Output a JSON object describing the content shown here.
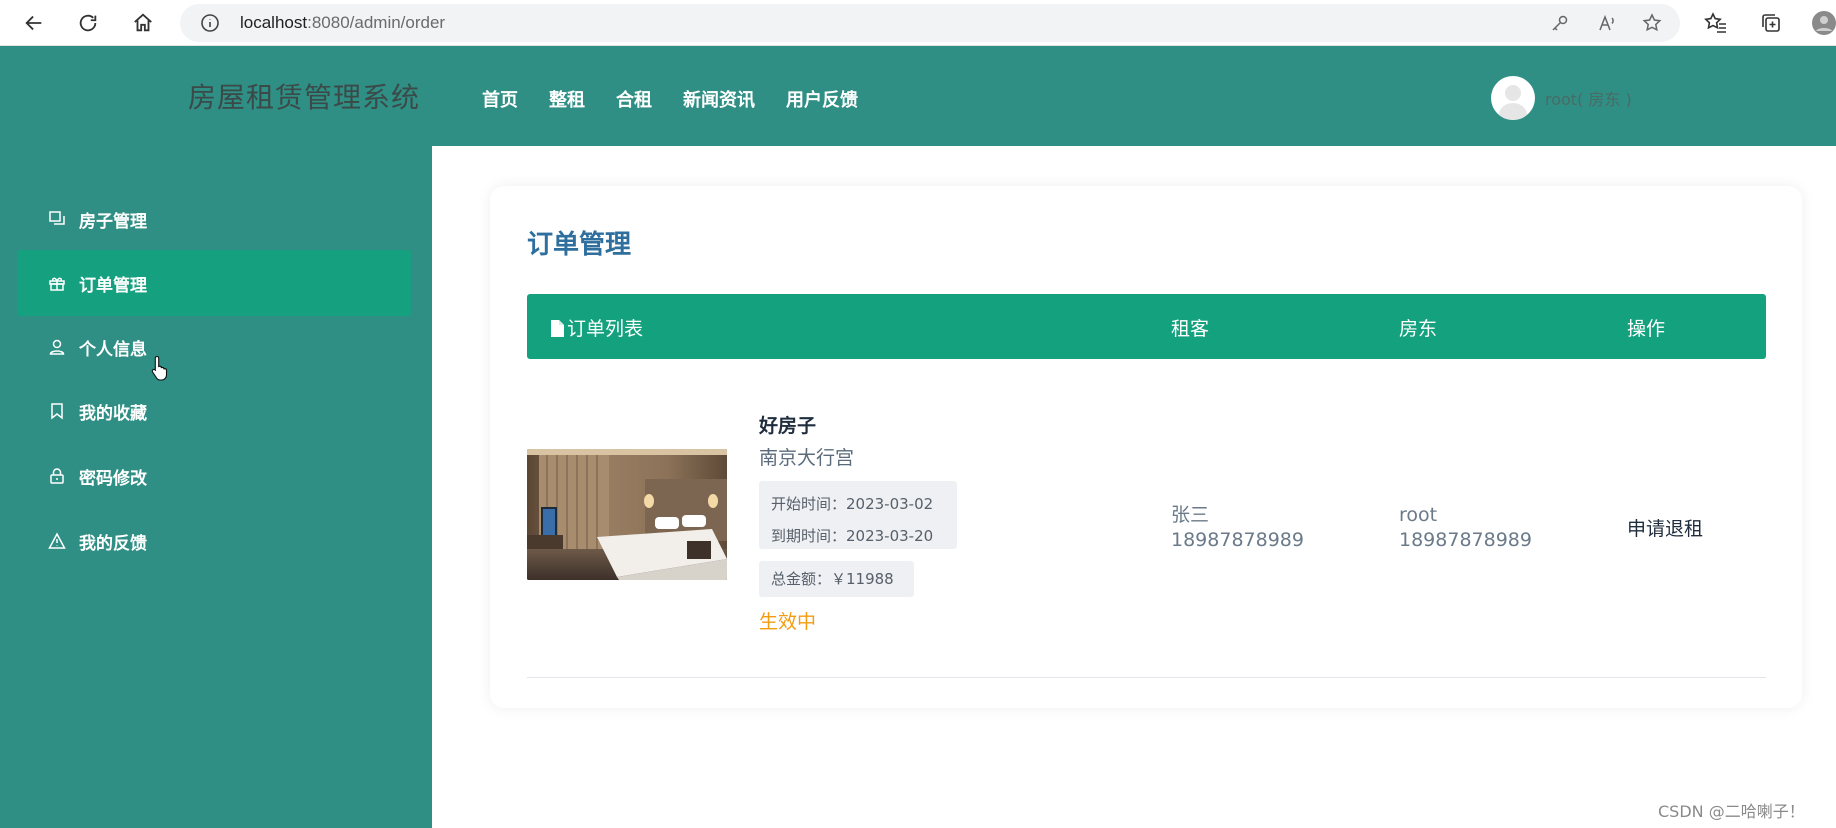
{
  "browser": {
    "url_host": "localhost",
    "url_rest": ":8080/admin/order"
  },
  "header": {
    "logo": "房屋租赁管理系统",
    "nav": [
      "首页",
      "整租",
      "合租",
      "新闻资讯",
      "用户反馈"
    ],
    "user_name": "root( 房东 )"
  },
  "sidebar": {
    "items": [
      {
        "label": "房子管理",
        "icon": "copy-icon"
      },
      {
        "label": "订单管理",
        "icon": "gift-icon"
      },
      {
        "label": "个人信息",
        "icon": "user-icon"
      },
      {
        "label": "我的收藏",
        "icon": "bookmark-icon"
      },
      {
        "label": "密码修改",
        "icon": "lock-icon"
      },
      {
        "label": "我的反馈",
        "icon": "warning-icon"
      }
    ],
    "active_index": 1
  },
  "main": {
    "title": "订单管理",
    "table_head": {
      "list": "订单列表",
      "tenant": "租客",
      "landlord": "房东",
      "action": "操作"
    },
    "orders": [
      {
        "house_title": "好房子",
        "address": "南京大行宫",
        "start": "开始时间：2023-03-02",
        "end": "到期时间：2023-03-20",
        "amount": "总金额：￥11988",
        "status": "生效中",
        "tenant_name": "张三",
        "tenant_phone": "18987878989",
        "landlord_name": "root",
        "landlord_phone": "18987878989",
        "action": "申请退租"
      }
    ]
  },
  "watermark": "CSDN @二哈喇子！",
  "colors": {
    "header_bg": "#2f8f84",
    "active_item": "#15a080",
    "table_head_bg": "#14a27e",
    "title": "#2e6f9e",
    "status": "#f39c12"
  }
}
